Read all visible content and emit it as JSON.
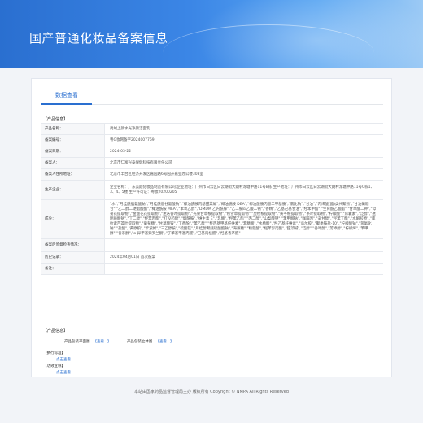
{
  "header": {
    "title": "国产普通化妆品备案信息"
  },
  "tab": {
    "label": "数据查看"
  },
  "product_section": "【产品信息】",
  "rows": [
    {
      "label": "产品名称：",
      "value": "尚绒上颜水光净颜洁面乳"
    },
    {
      "label": "备案编号：",
      "value": "粤G妆网备字2024007769"
    },
    {
      "label": "备案日期：",
      "value": "2024-03-22"
    },
    {
      "label": "备案人：",
      "value": "北京市仁富兴泰保健科技有限责任公司"
    },
    {
      "label": "备案人住所地址：",
      "value": "北京市丰台区经济开发区嘉园路6号园开嘉业办公楼303室"
    },
    {
      "label": "生产企业：",
      "value": "企业名称：广东美颜化妆品制造有限公司;企业地址：广州市白云区白云湖街大朗村龙塘中路11号B栋 生产地址：广州市白云区白云湖街大朗村龙塘中路11号C栋1、3、4、5楼 生产许可证：粤妆20200205"
    },
    {
      "label": "成分：",
      "value": "\"水\",\"月桂酰肌氨酸钠\",\"月桂酰基谷氨酸钠\",\"椰油酰胺丙基甜菜碱\",\"椰油酰胺 DEA\",\"椰油酰胺丙基二甲基胺\",\"氯化钠\",\"甘油\",\"丙烯酸(酯)类共聚物\",\"甘油葡糖苷\",\"乙二醇二硬脂酸酯\",\"椰油酰胺 MEA\",\"苯氧乙醇\",\"DMDM 乙内酰脲\",\"乙二胺四乙酸二钠\",\"香精\",\"乙基己基甘油\",\"羟苯甲酯\",\"生育酚乙酸酯\",\"甘草酸二钾\",\"母菊花提取物\",\"金盏花花提取物\",\"迷迭香叶提取物\",\"光果甘草根提取物\",\"积雪草提取物\",\"虎杖根提取物\",\"黄芩根提取物\",\"茶叶提取物\",\"柠檬酸\",\"尿囊素\",\"泛醇\",\"透明质酸钠\",\"丁二醇\",\"羟苯丙酯\",\"红没药醇\",\"烟酰胺\",\"维生素 E\",\"乳酸\",\"羟苯乙酯\",\"丙二醇\",\"山梨酸钾\",\"苯甲酸钠\",\"咖啡因\",\"辛甘醇\",\"羟苯丁酯\",\"水解胶原\",\"库拉索芦荟叶提取物\",\"葡萄糖\",\"甘草酸铵\",\"丁香酚\",\"苯乙醇\",\"羟丙基甲基纤维素\",\"乳糖酸\",\"水杨酸\",\"羟乙基纤维素\",\"瓜尔胶\",\"聚季铵盐-10\",\"柠檬酸钠\",\"氢氧化钠\",\"盐酸\",\"黄原胶\",\"卡波姆\",\"三乙醇胺\",\"硫酸镁\",\"月桂醇聚醚硫酸酯钠\",\"海藻糖\",\"精氨酸\",\"羟苯异丙酯\",\"甜菜碱\",\"泛醇\",\"香叶醇\",\"芳樟醇\",\"柠檬烯\",\"苯甲醇\",\"香茅醇\",\"α-异甲基紫罗兰酮\",\"丁苯基甲基丙醛\",\"己基肉桂醛\",\"羟基香茅醛\""
    },
    {
      "label": "备案后监督检查情况：",
      "value": ""
    },
    {
      "label": "历史记录：",
      "value": "2024年04月01日 首次备案"
    },
    {
      "label": "备注：",
      "value": ""
    }
  ],
  "files_section": "【产品信息】",
  "files": {
    "plan_label": "产品包装平面图",
    "plan_link": "查看",
    "stereo_label": "产品包装立体图",
    "stereo_link": "查看"
  },
  "standard": {
    "head": "【执行标准】",
    "link": "点击查看"
  },
  "efficacy": {
    "head": "【功效宣称】",
    "link": "点击查看"
  },
  "footer": "本站由国家药品监督管理局主办 版权所有 Copyright © NMPA All Rights Reserved"
}
